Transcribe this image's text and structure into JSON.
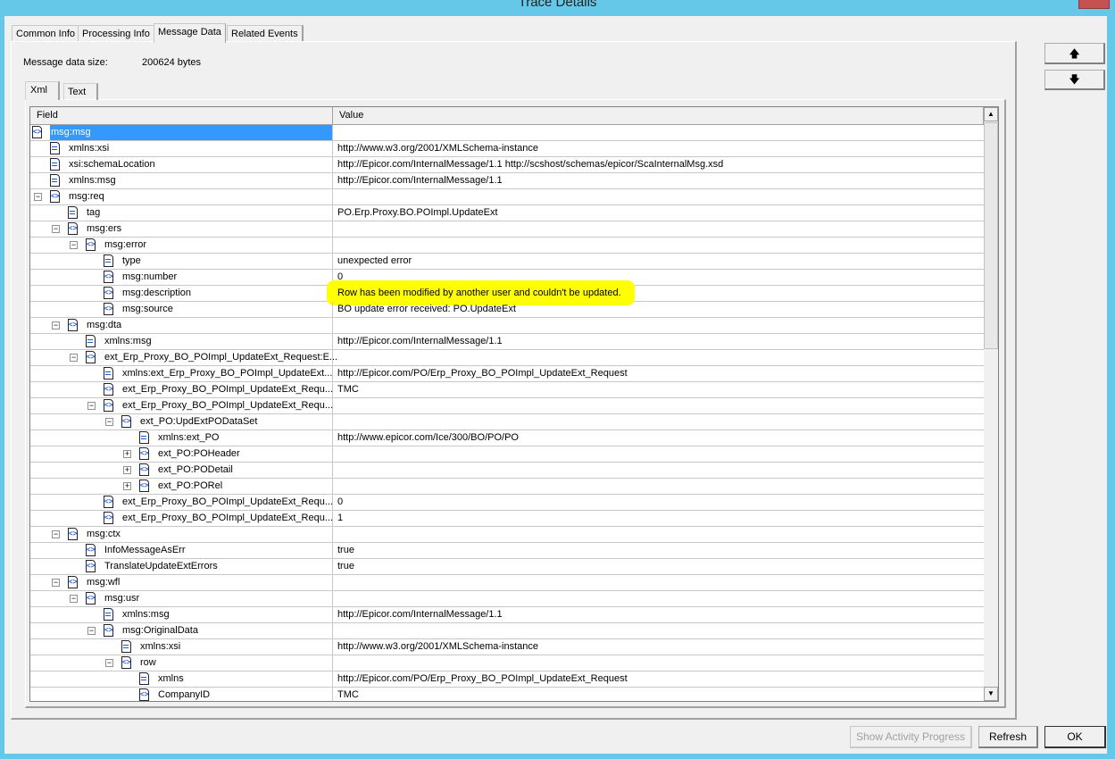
{
  "window": {
    "title": "Trace Details"
  },
  "tabs": [
    {
      "label": "Common Info",
      "active": false
    },
    {
      "label": "Processing Info",
      "active": false
    },
    {
      "label": "Message Data",
      "active": true
    },
    {
      "label": "Related Events",
      "active": false
    }
  ],
  "message": {
    "size_label": "Message data size:",
    "size_value": "200624 bytes"
  },
  "inner_tabs": [
    {
      "label": "Xml",
      "active": true
    },
    {
      "label": "Text",
      "active": false
    }
  ],
  "grid": {
    "columns": [
      "Field",
      "Value"
    ],
    "highlight_color": "#FFFF00",
    "selection_color": "#3399FF",
    "rows": [
      {
        "field": "msg:msg",
        "value": "",
        "level": 0,
        "type": "element",
        "expander": "none",
        "selected": true
      },
      {
        "field": "xmlns:xsi",
        "value": "http://www.w3.org/2001/XMLSchema-instance",
        "level": 1,
        "type": "attribute",
        "expander": "none"
      },
      {
        "field": "xsi:schemaLocation",
        "value": "http://Epicor.com/InternalMessage/1.1 http://scshost/schemas/epicor/ScaInternalMsg.xsd",
        "level": 1,
        "type": "attribute",
        "expander": "none"
      },
      {
        "field": "xmlns:msg",
        "value": "http://Epicor.com/InternalMessage/1.1",
        "level": 1,
        "type": "attribute",
        "expander": "none"
      },
      {
        "field": "msg:req",
        "value": "",
        "level": 1,
        "type": "element",
        "expander": "minus"
      },
      {
        "field": "tag",
        "value": "PO.Erp.Proxy.BO.POImpl.UpdateExt",
        "level": 2,
        "type": "attribute",
        "expander": "none"
      },
      {
        "field": "msg:ers",
        "value": "",
        "level": 2,
        "type": "element",
        "expander": "minus"
      },
      {
        "field": "msg:error",
        "value": "",
        "level": 3,
        "type": "element",
        "expander": "minus"
      },
      {
        "field": "type",
        "value": "unexpected error",
        "level": 4,
        "type": "attribute",
        "expander": "none"
      },
      {
        "field": "msg:number",
        "value": "0",
        "level": 4,
        "type": "element",
        "expander": "none"
      },
      {
        "field": "msg:description",
        "value": "Row has been modified by another user and couldn't be updated.",
        "level": 4,
        "type": "element",
        "expander": "none",
        "highlighted": true
      },
      {
        "field": "msg:source",
        "value": "BO update error received: PO.UpdateExt",
        "level": 4,
        "type": "element",
        "expander": "none"
      },
      {
        "field": "msg:dta",
        "value": "",
        "level": 2,
        "type": "element",
        "expander": "minus"
      },
      {
        "field": "xmlns:msg",
        "value": "http://Epicor.com/InternalMessage/1.1",
        "level": 3,
        "type": "attribute",
        "expander": "none"
      },
      {
        "field": "ext_Erp_Proxy_BO_POImpl_UpdateExt_Request:E...",
        "value": "",
        "level": 3,
        "type": "element",
        "expander": "minus"
      },
      {
        "field": "xmlns:ext_Erp_Proxy_BO_POImpl_UpdateExt...",
        "value": "http://Epicor.com/PO/Erp_Proxy_BO_POImpl_UpdateExt_Request",
        "level": 4,
        "type": "attribute",
        "expander": "none"
      },
      {
        "field": "ext_Erp_Proxy_BO_POImpl_UpdateExt_Requ...",
        "value": "TMC",
        "level": 4,
        "type": "element",
        "expander": "none"
      },
      {
        "field": "ext_Erp_Proxy_BO_POImpl_UpdateExt_Requ...",
        "value": "",
        "level": 4,
        "type": "element",
        "expander": "minus"
      },
      {
        "field": "ext_PO:UpdExtPODataSet",
        "value": "",
        "level": 5,
        "type": "element",
        "expander": "minus"
      },
      {
        "field": "xmlns:ext_PO",
        "value": "http://www.epicor.com/Ice/300/BO/PO/PO",
        "level": 6,
        "type": "attribute",
        "expander": "none"
      },
      {
        "field": "ext_PO:POHeader",
        "value": "",
        "level": 6,
        "type": "element",
        "expander": "plus"
      },
      {
        "field": "ext_PO:PODetail",
        "value": "",
        "level": 6,
        "type": "element",
        "expander": "plus"
      },
      {
        "field": "ext_PO:PORel",
        "value": "",
        "level": 6,
        "type": "element",
        "expander": "plus"
      },
      {
        "field": "ext_Erp_Proxy_BO_POImpl_UpdateExt_Requ...",
        "value": "0",
        "level": 4,
        "type": "element",
        "expander": "none"
      },
      {
        "field": "ext_Erp_Proxy_BO_POImpl_UpdateExt_Requ...",
        "value": "1",
        "level": 4,
        "type": "element",
        "expander": "none"
      },
      {
        "field": "msg:ctx",
        "value": "",
        "level": 2,
        "type": "element",
        "expander": "minus"
      },
      {
        "field": "InfoMessageAsErr",
        "value": "true",
        "level": 3,
        "type": "element",
        "expander": "none"
      },
      {
        "field": "TranslateUpdateExtErrors",
        "value": "true",
        "level": 3,
        "type": "element",
        "expander": "none"
      },
      {
        "field": "msg:wfl",
        "value": "",
        "level": 2,
        "type": "element",
        "expander": "minus"
      },
      {
        "field": "msg:usr",
        "value": "",
        "level": 3,
        "type": "element",
        "expander": "minus"
      },
      {
        "field": "xmlns:msg",
        "value": "http://Epicor.com/InternalMessage/1.1",
        "level": 4,
        "type": "attribute",
        "expander": "none"
      },
      {
        "field": "msg:OriginalData",
        "value": "",
        "level": 4,
        "type": "element",
        "expander": "minus"
      },
      {
        "field": "xmlns:xsi",
        "value": "http://www.w3.org/2001/XMLSchema-instance",
        "level": 5,
        "type": "attribute",
        "expander": "none"
      },
      {
        "field": "row",
        "value": "",
        "level": 5,
        "type": "element",
        "expander": "minus"
      },
      {
        "field": "xmlns",
        "value": "http://Epicor.com/PO/Erp_Proxy_BO_POImpl_UpdateExt_Request",
        "level": 6,
        "type": "attribute",
        "expander": "none"
      },
      {
        "field": "CompanyID",
        "value": "TMC",
        "level": 6,
        "type": "element",
        "expander": "none"
      }
    ]
  },
  "nav": {
    "up_icon": "arrow-up-icon",
    "down_icon": "arrow-down-icon"
  },
  "buttons": {
    "show_activity": "Show Activity Progress",
    "refresh": "Refresh",
    "ok": "OK"
  }
}
